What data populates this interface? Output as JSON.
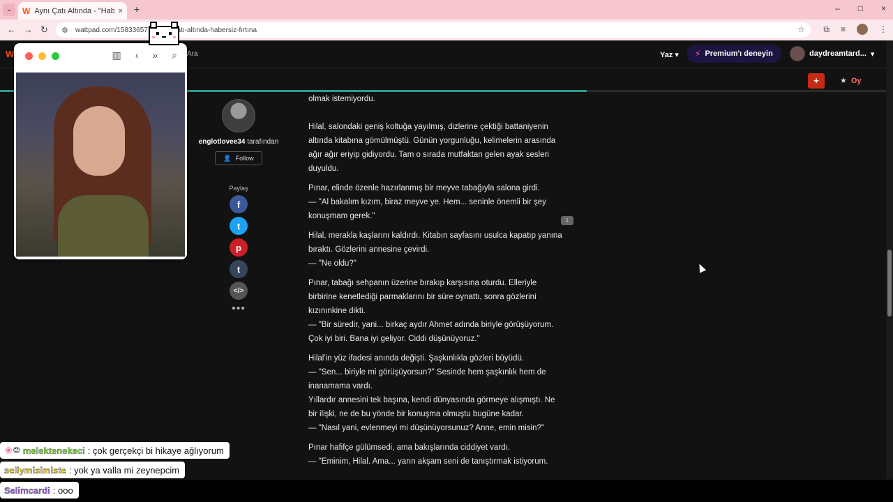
{
  "browser": {
    "tab": {
      "title": "Aynı Çatı Altında - \"Habersiz F...",
      "close": "×"
    },
    "new_tab": "+",
    "url": "wattpad.com/1583365715-aynı-çatı-altında-habersiz-fırtına",
    "window_controls": [
      "–",
      "□",
      "×"
    ]
  },
  "wattpad": {
    "search_label": "Ara",
    "write_label": "Yaz",
    "premium_label": "Premium'ı deneyin",
    "username": "daydreamtard...",
    "add_label": "+",
    "vote_label": "Oy",
    "reading_progress": 0.657,
    "author": {
      "name": "englotlovee34",
      "suffix": " tarafından",
      "follow_label": "Follow"
    },
    "share_label": "Paylaş",
    "share_icons": [
      "facebook-icon",
      "twitter-icon",
      "pinterest-icon",
      "tumblr-icon",
      "embed-icon",
      "more-icon"
    ],
    "comment_count": "1",
    "story_paragraphs": [
      "olmak istemiyordu.",
      "Hilal, salondaki geniş koltuğa yayılmış, dizlerine çektiği battaniyenin altında kitabına gömülmüştü. Günün yorgunluğu, kelimelerin arasında ağır ağır eriyip gidiyordu. Tam o sırada mutfaktan gelen ayak sesleri duyuldu.",
      "Pınar, elinde özenle hazırlanmış bir meyve tabağıyla salona girdi.\n— \"Al bakalım kızım, biraz meyve ye. Hem... seninle önemli bir şey konuşmam gerek.\"",
      "Hilal, merakla kaşlarını kaldırdı. Kitabın sayfasını usulca kapatıp yanına bıraktı. Gözlerini annesine çevirdi.\n— \"Ne oldu?\"",
      "Pınar, tabağı sehpanın üzerine bırakıp karşısına oturdu. Elleriyle birbirine kenetlediği parmaklarını bir süre oynattı, sonra gözlerini kızınınkine dikti.\n— \"Bir süredir, yani... birkaç aydır Ahmet adında biriyle görüşüyorum. Çok iyi biri. Bana iyi geliyor. Ciddi düşünüyoruz.\"",
      "Hilal'in yüz ifadesi anında değişti. Şaşkınlıkla gözleri büyüdü.\n— \"Sen... biriyle mi görüşüyorsun?\" Sesinde hem şaşkınlık hem de inanamama vardı.\nYıllardır annesini tek başına, kendi dünyasında görmeye alışmıştı. Ne bir ilişki, ne de bu yönde bir konuşma olmuştu bugüne kadar.\n— \"Nasıl yani, evlenmeyi mi düşünüyorsunuz? Anne, emin misin?\"",
      "Pınar hafifçe gülümsedi, ama bakışlarında ciddiyet vardı.\n— \"Eminim, Hilal. Ama... yarın akşam seni de tanıştırmak istiyorum."
    ]
  },
  "chat": [
    {
      "badge": "🌸😊",
      "user": "melektenekeci",
      "message": ": çok gerçekçi bi hikaye ağlıyorum"
    },
    {
      "badge": "",
      "user": "seliymisimiste",
      "message": ": yok ya valla mi zeynepcim"
    },
    {
      "badge": "",
      "user": "Selimcardi",
      "message": ": ooo"
    }
  ]
}
